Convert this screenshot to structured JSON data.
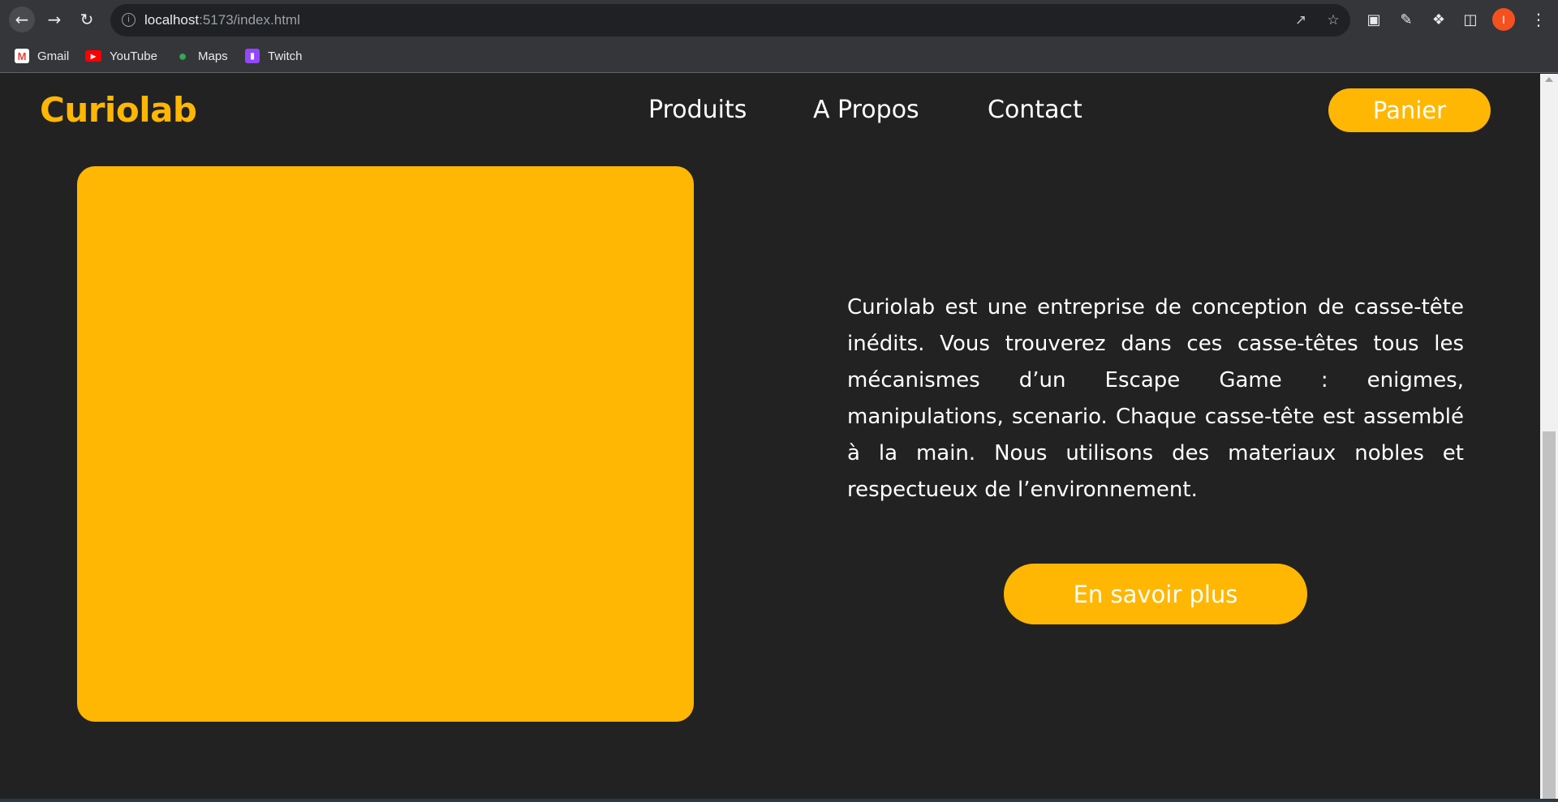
{
  "browser": {
    "url_host": "localhost",
    "url_rest": ":5173/index.html",
    "profile_initial": "I",
    "bookmarks": [
      {
        "label": "Gmail",
        "icon": "gmail-icon"
      },
      {
        "label": "YouTube",
        "icon": "youtube-icon"
      },
      {
        "label": "Maps",
        "icon": "maps-icon"
      },
      {
        "label": "Twitch",
        "icon": "twitch-icon"
      }
    ]
  },
  "site": {
    "logo": "Curiolab",
    "nav": [
      "Produits",
      "A Propos",
      "Contact"
    ],
    "cart_label": "Panier"
  },
  "about": {
    "text": "Curiolab est une entreprise de conception de casse-tête inédits. Vous trouverez dans ces casse-têtes tous les mécanismes d’un Escape Game : enigmes, manipulations, scenario. Chaque casse-tête est assemblé à la main. Nous utilisons des materiaux nobles et respectueux de l’environnement.",
    "button_label": "En savoir plus"
  },
  "colors": {
    "accent": "#ffb703",
    "background": "#222222",
    "text": "#ffffff"
  }
}
